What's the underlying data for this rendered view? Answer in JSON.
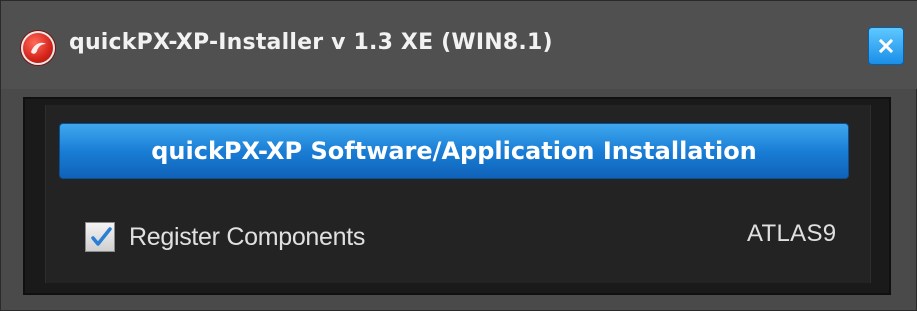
{
  "window": {
    "title": "quickPX-XP-Installer v 1.3 XE (WIN8.1)",
    "app_icon": "app-logo-icon",
    "close_icon": "close-icon"
  },
  "main": {
    "install_button_label": "quickPX-XP Software/Application Installation",
    "register_checkbox": {
      "label": "Register Components",
      "checked": true
    },
    "build_label": "ATLAS9"
  },
  "colors": {
    "accent": "#1a7ed6",
    "background": "#4a4a4a",
    "panel": "#1a1a1a"
  }
}
